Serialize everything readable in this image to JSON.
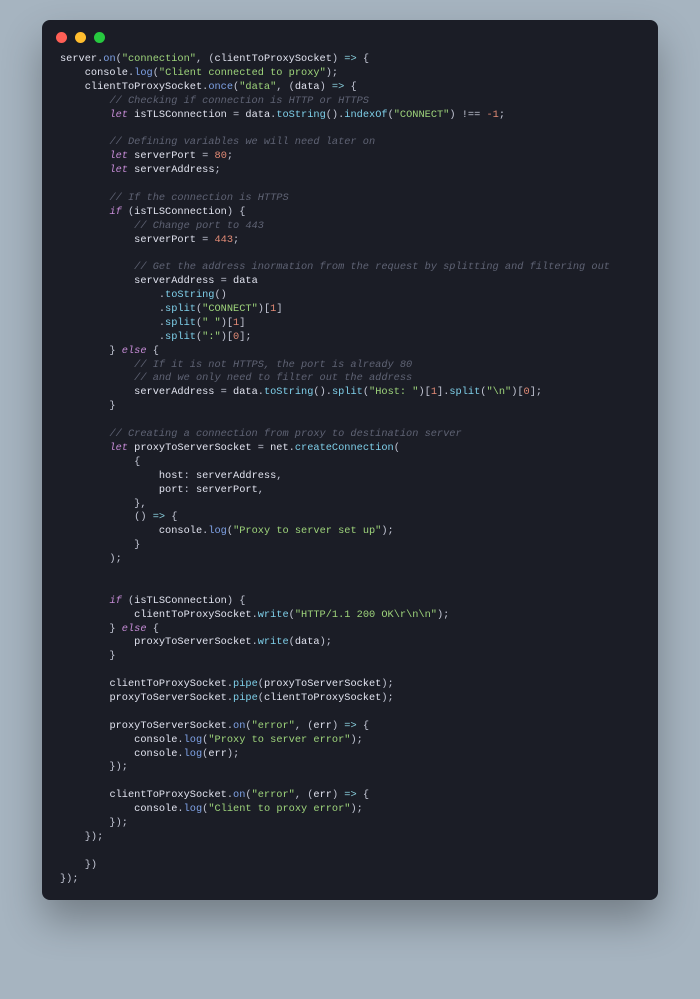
{
  "window": {
    "traffic_lights": [
      "close",
      "minimize",
      "maximize"
    ]
  },
  "code": {
    "lines": [
      [
        [
          "v",
          "server"
        ],
        [
          "p",
          "."
        ],
        [
          "f",
          "on"
        ],
        [
          "p",
          "("
        ],
        [
          "s",
          "\"connection\""
        ],
        [
          "p",
          ", ("
        ],
        [
          "v",
          "clientToProxySocket"
        ],
        [
          "p",
          ") "
        ],
        [
          "o",
          "=>"
        ],
        [
          "p",
          " {"
        ]
      ],
      [
        [
          "p",
          "    "
        ],
        [
          "v",
          "console"
        ],
        [
          "p",
          "."
        ],
        [
          "f",
          "log"
        ],
        [
          "p",
          "("
        ],
        [
          "s",
          "\"Client connected to proxy\""
        ],
        [
          "p",
          ");"
        ]
      ],
      [
        [
          "p",
          "    "
        ],
        [
          "v",
          "clientToProxySocket"
        ],
        [
          "p",
          "."
        ],
        [
          "f",
          "once"
        ],
        [
          "p",
          "("
        ],
        [
          "s",
          "\"data\""
        ],
        [
          "p",
          ", ("
        ],
        [
          "v",
          "data"
        ],
        [
          "p",
          ") "
        ],
        [
          "o",
          "=>"
        ],
        [
          "p",
          " {"
        ]
      ],
      [
        [
          "p",
          "        "
        ],
        [
          "c",
          "// Checking if connection is HTTP or HTTPS"
        ]
      ],
      [
        [
          "p",
          "        "
        ],
        [
          "k",
          "let"
        ],
        [
          "p",
          " "
        ],
        [
          "v",
          "isTLSConnection"
        ],
        [
          "p",
          " = "
        ],
        [
          "v",
          "data"
        ],
        [
          "p",
          "."
        ],
        [
          "m",
          "toString"
        ],
        [
          "p",
          "()."
        ],
        [
          "m",
          "indexOf"
        ],
        [
          "p",
          "("
        ],
        [
          "s",
          "\"CONNECT\""
        ],
        [
          "p",
          ") !== "
        ],
        [
          "n",
          "-1"
        ],
        [
          "p",
          ";"
        ]
      ],
      [
        [
          "p",
          " "
        ]
      ],
      [
        [
          "p",
          "        "
        ],
        [
          "c",
          "// Defining variables we will need later on"
        ]
      ],
      [
        [
          "p",
          "        "
        ],
        [
          "k",
          "let"
        ],
        [
          "p",
          " "
        ],
        [
          "v",
          "serverPort"
        ],
        [
          "p",
          " = "
        ],
        [
          "n",
          "80"
        ],
        [
          "p",
          ";"
        ]
      ],
      [
        [
          "p",
          "        "
        ],
        [
          "k",
          "let"
        ],
        [
          "p",
          " "
        ],
        [
          "v",
          "serverAddress"
        ],
        [
          "p",
          ";"
        ]
      ],
      [
        [
          "p",
          " "
        ]
      ],
      [
        [
          "p",
          "        "
        ],
        [
          "c",
          "// If the connection is HTTPS"
        ]
      ],
      [
        [
          "p",
          "        "
        ],
        [
          "k",
          "if"
        ],
        [
          "p",
          " ("
        ],
        [
          "v",
          "isTLSConnection"
        ],
        [
          "p",
          ") {"
        ]
      ],
      [
        [
          "p",
          "            "
        ],
        [
          "c",
          "// Change port to 443"
        ]
      ],
      [
        [
          "p",
          "            "
        ],
        [
          "v",
          "serverPort"
        ],
        [
          "p",
          " = "
        ],
        [
          "n",
          "443"
        ],
        [
          "p",
          ";"
        ]
      ],
      [
        [
          "p",
          " "
        ]
      ],
      [
        [
          "p",
          "            "
        ],
        [
          "c",
          "// Get the address inormation from the request by splitting and filtering out"
        ]
      ],
      [
        [
          "p",
          "            "
        ],
        [
          "v",
          "serverAddress"
        ],
        [
          "p",
          " = "
        ],
        [
          "v",
          "data"
        ]
      ],
      [
        [
          "p",
          "                ."
        ],
        [
          "m",
          "toString"
        ],
        [
          "p",
          "()"
        ]
      ],
      [
        [
          "p",
          "                ."
        ],
        [
          "m",
          "split"
        ],
        [
          "p",
          "("
        ],
        [
          "s",
          "\"CONNECT\""
        ],
        [
          "p",
          ")["
        ],
        [
          "n",
          "1"
        ],
        [
          "p",
          "]"
        ]
      ],
      [
        [
          "p",
          "                ."
        ],
        [
          "m",
          "split"
        ],
        [
          "p",
          "("
        ],
        [
          "s",
          "\" \""
        ],
        [
          "p",
          ")["
        ],
        [
          "n",
          "1"
        ],
        [
          "p",
          "]"
        ]
      ],
      [
        [
          "p",
          "                ."
        ],
        [
          "m",
          "split"
        ],
        [
          "p",
          "("
        ],
        [
          "s",
          "\":\""
        ],
        [
          "p",
          ")["
        ],
        [
          "n",
          "0"
        ],
        [
          "p",
          "];"
        ]
      ],
      [
        [
          "p",
          "        } "
        ],
        [
          "k",
          "else"
        ],
        [
          "p",
          " {"
        ]
      ],
      [
        [
          "p",
          "            "
        ],
        [
          "c",
          "// If it is not HTTPS, the port is already 80"
        ]
      ],
      [
        [
          "p",
          "            "
        ],
        [
          "c",
          "// and we only need to filter out the address"
        ]
      ],
      [
        [
          "p",
          "            "
        ],
        [
          "v",
          "serverAddress"
        ],
        [
          "p",
          " = "
        ],
        [
          "v",
          "data"
        ],
        [
          "p",
          "."
        ],
        [
          "m",
          "toString"
        ],
        [
          "p",
          "()."
        ],
        [
          "m",
          "split"
        ],
        [
          "p",
          "("
        ],
        [
          "s",
          "\"Host: \""
        ],
        [
          "p",
          ")["
        ],
        [
          "n",
          "1"
        ],
        [
          "p",
          "]."
        ],
        [
          "m",
          "split"
        ],
        [
          "p",
          "("
        ],
        [
          "s",
          "\"\\n\""
        ],
        [
          "p",
          ")["
        ],
        [
          "n",
          "0"
        ],
        [
          "p",
          "];"
        ]
      ],
      [
        [
          "p",
          "        }"
        ]
      ],
      [
        [
          "p",
          " "
        ]
      ],
      [
        [
          "p",
          "        "
        ],
        [
          "c",
          "// Creating a connection from proxy to destination server"
        ]
      ],
      [
        [
          "p",
          "        "
        ],
        [
          "k",
          "let"
        ],
        [
          "p",
          " "
        ],
        [
          "v",
          "proxyToServerSocket"
        ],
        [
          "p",
          " = "
        ],
        [
          "v",
          "net"
        ],
        [
          "p",
          "."
        ],
        [
          "m",
          "createConnection"
        ],
        [
          "p",
          "("
        ]
      ],
      [
        [
          "p",
          "            {"
        ]
      ],
      [
        [
          "p",
          "                "
        ],
        [
          "pr",
          "host"
        ],
        [
          "p",
          ": "
        ],
        [
          "v",
          "serverAddress"
        ],
        [
          "p",
          ","
        ]
      ],
      [
        [
          "p",
          "                "
        ],
        [
          "pr",
          "port"
        ],
        [
          "p",
          ": "
        ],
        [
          "v",
          "serverPort"
        ],
        [
          "p",
          ","
        ]
      ],
      [
        [
          "p",
          "            },"
        ]
      ],
      [
        [
          "p",
          "            () "
        ],
        [
          "o",
          "=>"
        ],
        [
          "p",
          " {"
        ]
      ],
      [
        [
          "p",
          "                "
        ],
        [
          "v",
          "console"
        ],
        [
          "p",
          "."
        ],
        [
          "f",
          "log"
        ],
        [
          "p",
          "("
        ],
        [
          "s",
          "\"Proxy to server set up\""
        ],
        [
          "p",
          ");"
        ]
      ],
      [
        [
          "p",
          "            }"
        ]
      ],
      [
        [
          "p",
          "        );"
        ]
      ],
      [
        [
          "p",
          " "
        ]
      ],
      [
        [
          "p",
          " "
        ]
      ],
      [
        [
          "p",
          "        "
        ],
        [
          "k",
          "if"
        ],
        [
          "p",
          " ("
        ],
        [
          "v",
          "isTLSConnection"
        ],
        [
          "p",
          ") {"
        ]
      ],
      [
        [
          "p",
          "            "
        ],
        [
          "v",
          "clientToProxySocket"
        ],
        [
          "p",
          "."
        ],
        [
          "m",
          "write"
        ],
        [
          "p",
          "("
        ],
        [
          "s",
          "\"HTTP/1.1 200 OK\\r\\n\\n\""
        ],
        [
          "p",
          ");"
        ]
      ],
      [
        [
          "p",
          "        } "
        ],
        [
          "k",
          "else"
        ],
        [
          "p",
          " {"
        ]
      ],
      [
        [
          "p",
          "            "
        ],
        [
          "v",
          "proxyToServerSocket"
        ],
        [
          "p",
          "."
        ],
        [
          "m",
          "write"
        ],
        [
          "p",
          "("
        ],
        [
          "v",
          "data"
        ],
        [
          "p",
          ");"
        ]
      ],
      [
        [
          "p",
          "        }"
        ]
      ],
      [
        [
          "p",
          " "
        ]
      ],
      [
        [
          "p",
          "        "
        ],
        [
          "v",
          "clientToProxySocket"
        ],
        [
          "p",
          "."
        ],
        [
          "m",
          "pipe"
        ],
        [
          "p",
          "("
        ],
        [
          "v",
          "proxyToServerSocket"
        ],
        [
          "p",
          ");"
        ]
      ],
      [
        [
          "p",
          "        "
        ],
        [
          "v",
          "proxyToServerSocket"
        ],
        [
          "p",
          "."
        ],
        [
          "m",
          "pipe"
        ],
        [
          "p",
          "("
        ],
        [
          "v",
          "clientToProxySocket"
        ],
        [
          "p",
          ");"
        ]
      ],
      [
        [
          "p",
          " "
        ]
      ],
      [
        [
          "p",
          "        "
        ],
        [
          "v",
          "proxyToServerSocket"
        ],
        [
          "p",
          "."
        ],
        [
          "f",
          "on"
        ],
        [
          "p",
          "("
        ],
        [
          "s",
          "\"error\""
        ],
        [
          "p",
          ", ("
        ],
        [
          "v",
          "err"
        ],
        [
          "p",
          ") "
        ],
        [
          "o",
          "=>"
        ],
        [
          "p",
          " {"
        ]
      ],
      [
        [
          "p",
          "            "
        ],
        [
          "v",
          "console"
        ],
        [
          "p",
          "."
        ],
        [
          "f",
          "log"
        ],
        [
          "p",
          "("
        ],
        [
          "s",
          "\"Proxy to server error\""
        ],
        [
          "p",
          ");"
        ]
      ],
      [
        [
          "p",
          "            "
        ],
        [
          "v",
          "console"
        ],
        [
          "p",
          "."
        ],
        [
          "f",
          "log"
        ],
        [
          "p",
          "("
        ],
        [
          "v",
          "err"
        ],
        [
          "p",
          ");"
        ]
      ],
      [
        [
          "p",
          "        });"
        ]
      ],
      [
        [
          "p",
          " "
        ]
      ],
      [
        [
          "p",
          "        "
        ],
        [
          "v",
          "clientToProxySocket"
        ],
        [
          "p",
          "."
        ],
        [
          "f",
          "on"
        ],
        [
          "p",
          "("
        ],
        [
          "s",
          "\"error\""
        ],
        [
          "p",
          ", ("
        ],
        [
          "v",
          "err"
        ],
        [
          "p",
          ") "
        ],
        [
          "o",
          "=>"
        ],
        [
          "p",
          " {"
        ]
      ],
      [
        [
          "p",
          "            "
        ],
        [
          "v",
          "console"
        ],
        [
          "p",
          "."
        ],
        [
          "f",
          "log"
        ],
        [
          "p",
          "("
        ],
        [
          "s",
          "\"Client to proxy error\""
        ],
        [
          "p",
          ");"
        ]
      ],
      [
        [
          "p",
          "        });"
        ]
      ],
      [
        [
          "p",
          "    });"
        ]
      ],
      [
        [
          "p",
          " "
        ]
      ],
      [
        [
          "p",
          "    })"
        ]
      ],
      [
        [
          "p",
          "});"
        ]
      ]
    ]
  }
}
